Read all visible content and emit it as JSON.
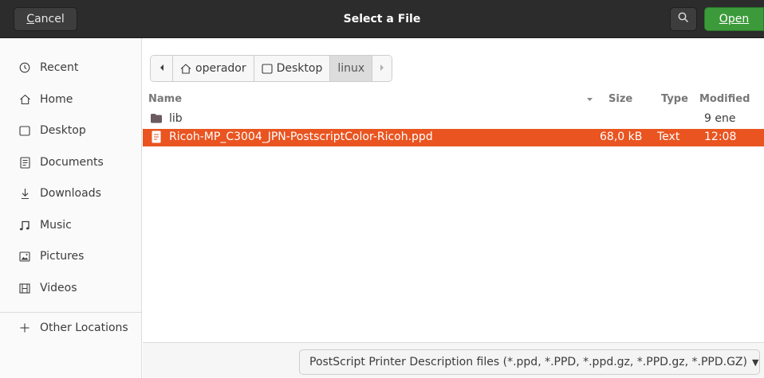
{
  "header": {
    "cancel_label": "ancel",
    "cancel_mnemonic": "C",
    "title": "Select a File",
    "open_label": "Open"
  },
  "sidebar": {
    "items": [
      {
        "label": "Recent",
        "icon": "clock-icon"
      },
      {
        "label": "Home",
        "icon": "home-icon"
      },
      {
        "label": "Desktop",
        "icon": "desktop-icon"
      },
      {
        "label": "Documents",
        "icon": "document-icon"
      },
      {
        "label": "Downloads",
        "icon": "download-icon"
      },
      {
        "label": "Music",
        "icon": "music-icon"
      },
      {
        "label": "Pictures",
        "icon": "picture-icon"
      },
      {
        "label": "Videos",
        "icon": "film-icon"
      }
    ],
    "other_locations": "Other Locations"
  },
  "pathbar": {
    "crumbs": [
      "operador",
      "Desktop",
      "linux"
    ]
  },
  "filelist": {
    "columns": {
      "name": "Name",
      "size": "Size",
      "type": "Type",
      "modified": "Modified"
    },
    "rows": [
      {
        "name": "lib",
        "size": "",
        "type": "",
        "modified": "9 ene",
        "icon": "folder-icon",
        "selected": false
      },
      {
        "name": "Ricoh-MP_C3004_JPN-PostscriptColor-Ricoh.ppd",
        "size": "68,0 kB",
        "type": "Text",
        "modified": "12:08",
        "icon": "text-file-icon",
        "selected": true
      }
    ]
  },
  "footer": {
    "filter_label": "PostScript Printer Description files (*.ppd, *.PPD, *.ppd.gz, *.PPD.gz, *.PPD.GZ)"
  },
  "colors": {
    "header_bg": "#2c2c2c",
    "open_button": "#3c9a3a",
    "selection": "#e95420"
  }
}
